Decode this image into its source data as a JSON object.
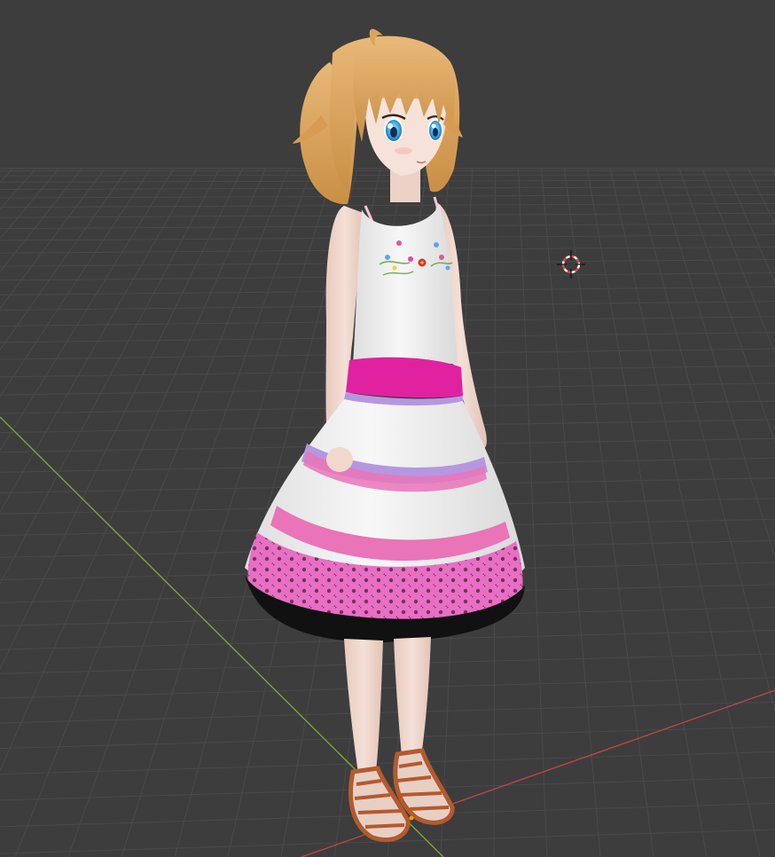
{
  "viewport": {
    "background_color": "#3d3d3d",
    "grid_color": "#4a4a4a",
    "x_axis_color": "#b8454a",
    "y_axis_color": "#7ea33a",
    "cursor_color": "#e04848",
    "origin_color": "#f0a000"
  },
  "character": {
    "hair_color": "#d9a55e",
    "skin_color": "#f2ddd3",
    "eye_color": "#49b2e8",
    "dress_color": "#f2f2f2",
    "sash_color": "#e022a0",
    "stripe_purple": "#b597e0",
    "stripe_pink": "#e974b8",
    "lace_color": "#e76fc4",
    "sandal_color": "#b35a2e"
  }
}
